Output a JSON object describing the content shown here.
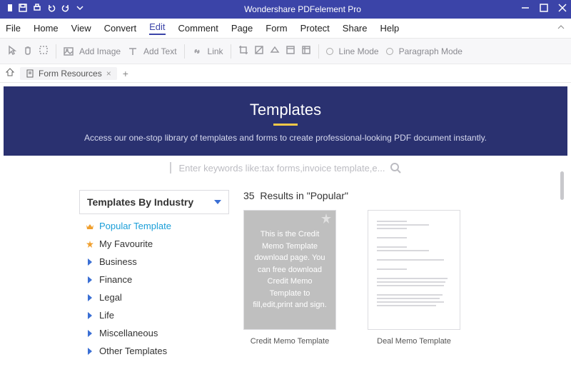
{
  "title": "Wondershare PDFelement Pro",
  "menu": [
    "File",
    "Home",
    "View",
    "Convert",
    "Edit",
    "Comment",
    "Page",
    "Form",
    "Protect",
    "Share",
    "Help"
  ],
  "menu_active": 4,
  "toolbar": {
    "add_image": "Add Image",
    "add_text": "Add Text",
    "link": "Link",
    "line_mode": "Line Mode",
    "para_mode": "Paragraph Mode"
  },
  "tab": {
    "label": "Form Resources"
  },
  "hero": {
    "title": "Templates",
    "sub": "Access our one-stop library of templates and forms to create professional-looking PDF document instantly."
  },
  "search": {
    "placeholder": "Enter keywords like:tax forms,invoice template,e..."
  },
  "sidebar": {
    "header": "Templates By Industry",
    "items": [
      {
        "label": "Popular Template",
        "icon": "crown",
        "active": true
      },
      {
        "label": "My Favourite",
        "icon": "star"
      },
      {
        "label": "Business",
        "icon": "caret"
      },
      {
        "label": "Finance",
        "icon": "caret"
      },
      {
        "label": "Legal",
        "icon": "caret"
      },
      {
        "label": "Life",
        "icon": "caret"
      },
      {
        "label": "Miscellaneous",
        "icon": "caret"
      },
      {
        "label": "Other Templates",
        "icon": "caret"
      }
    ]
  },
  "results": {
    "count": "35",
    "label": "Results in \"Popular\"",
    "items": [
      {
        "name": "Credit Memo Template",
        "preview_text": "This is the Credit Memo Template download page. You can free download Credit Memo Template to fill,edit,print and sign."
      },
      {
        "name": "Deal Memo Template"
      }
    ]
  }
}
